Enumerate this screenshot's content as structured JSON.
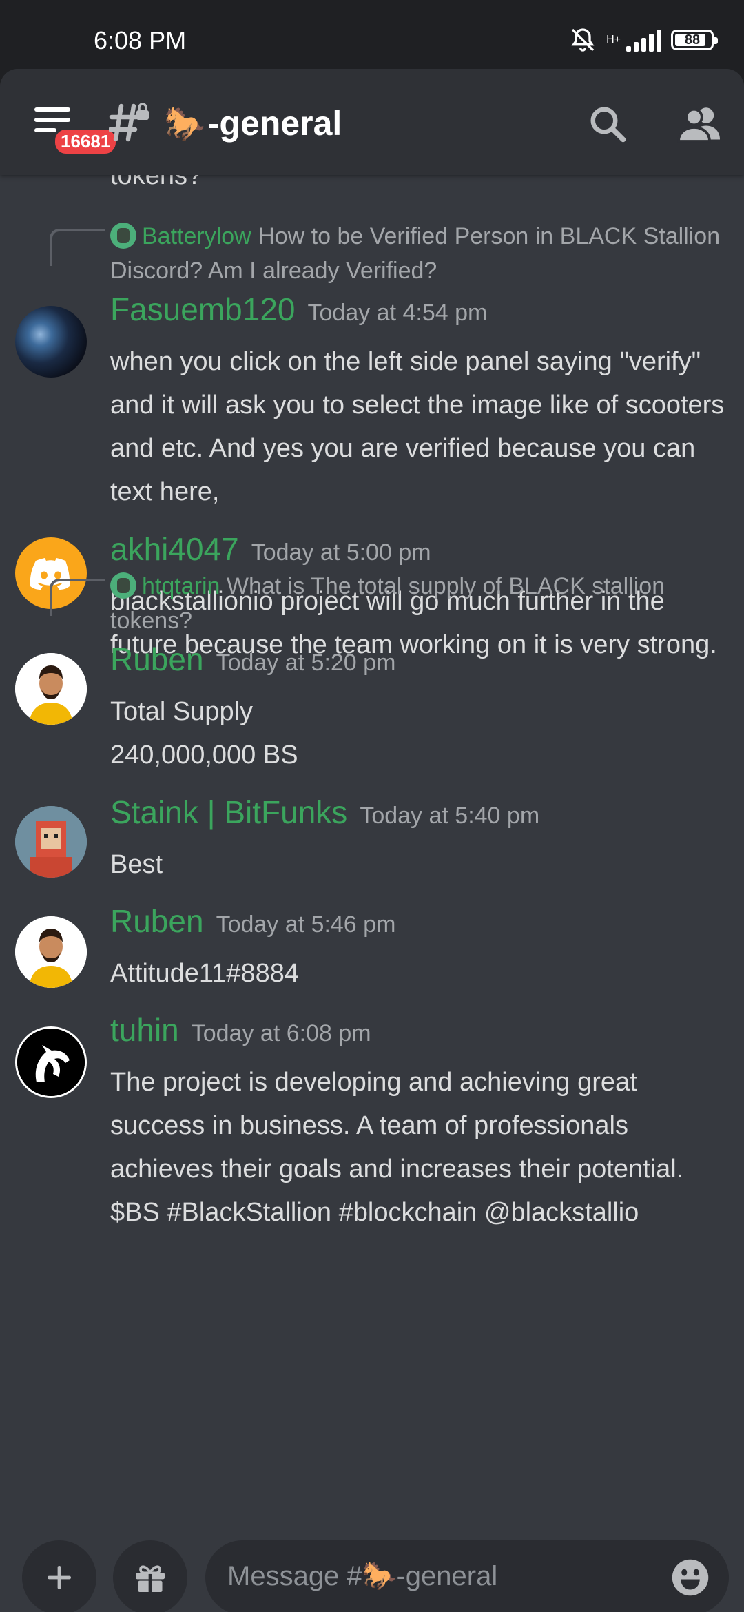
{
  "status_bar": {
    "time": "6:08 PM",
    "network": "H+",
    "battery": "88",
    "battery_level": 0.88
  },
  "header": {
    "unread_mentions": "16681",
    "channel_emoji": "🐎",
    "channel_name": "-general"
  },
  "feed": {
    "cutoff_text": "tokens?",
    "messages": [
      {
        "reply": {
          "name": "Batterylow",
          "text": "How to be Verified Person in BLACK Stallion Discord? Am I already Verified?"
        },
        "user": "Fasuemb120",
        "time": "Today at 4:54 pm",
        "text": "when you click on the left side panel saying \"verify\" and it will ask you to select the image like of scooters and etc. And yes you are verified because you can text here,"
      },
      {
        "user": "akhi4047",
        "time": "Today at 5:00 pm",
        "text": "blackstallionio project will go much further in the future because the team working on it is very strong."
      },
      {
        "reply": {
          "name": "htqtarin",
          "text": "What is The total supply of BLACK stallion tokens?"
        },
        "user": "Ruben",
        "time": "Today at 5:20 pm",
        "text": "Total Supply",
        "text2": "240,000,000 BS"
      },
      {
        "user": "Staink | BitFunks",
        "time": "Today at 5:40 pm",
        "text": "Best"
      },
      {
        "user": "Ruben",
        "time": "Today at 5:46 pm",
        "text": "Attitude11#8884"
      },
      {
        "user": "tuhin",
        "time": "Today at 6:08 pm",
        "text": "The project is developing and achieving great success in business. A team of professionals achieves their goals and increases their potential. $BS #BlackStallion #blockchain @blackstallio"
      }
    ]
  },
  "composer": {
    "placeholder_prefix": "Message #",
    "placeholder_emoji": "🐎",
    "placeholder_suffix": "-general"
  },
  "colors": {
    "background": "#36393f",
    "header": "#2f3136",
    "username_green": "#3ba55d",
    "badge_red": "#ed4245",
    "discord_orange": "#faa61a"
  },
  "icons": [
    "hamburger-menu-icon",
    "locked-text-channel-icon",
    "search-icon",
    "members-icon",
    "plus-icon",
    "gift-icon",
    "emoji-icon",
    "discord-logo-icon",
    "bell-off-icon",
    "signal-icon",
    "battery-icon"
  ]
}
